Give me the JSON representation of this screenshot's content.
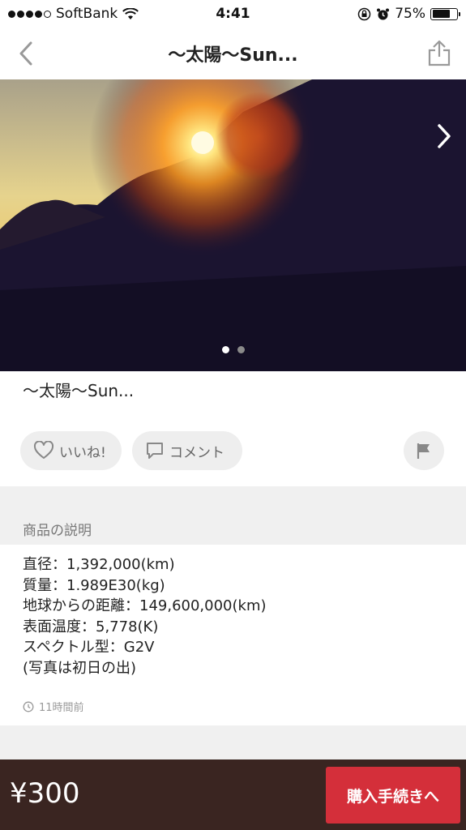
{
  "status_bar": {
    "carrier": "SoftBank",
    "time": "4:41",
    "battery": "75%",
    "signal_dots_filled": 4,
    "signal_dots_total": 5,
    "battery_level": 0.75
  },
  "nav": {
    "title": "〜太陽〜Sun...",
    "back_icon": "chevron-left-icon",
    "share_icon": "share-icon"
  },
  "photo": {
    "next_icon": "chevron-right-icon",
    "page_count": 2,
    "active_page": 1
  },
  "item": {
    "title": "〜太陽〜Sun..."
  },
  "actions": {
    "like_label": "いいね!",
    "comment_label": "コメント",
    "like_icon": "heart-icon",
    "comment_icon": "comment-icon",
    "flag_icon": "flag-icon"
  },
  "description": {
    "header": "商品の説明",
    "lines": [
      "直径：1,392,000(km)",
      "質量：1.989E30(kg)",
      "地球からの距離：149,600,000(km)",
      "表面温度：5,778(K)",
      "スペクトル型：G2V",
      "(写真は初日の出)"
    ],
    "timestamp": "11時間前",
    "timestamp_icon": "clock-icon"
  },
  "footer": {
    "price": "¥300",
    "buy_label": "購入手続きへ"
  },
  "colors": {
    "buy_button": "#d42f3a",
    "bottom_bar": "#3a2521",
    "section_bg": "#f0f0f0",
    "pill_bg": "#eeeeee"
  }
}
